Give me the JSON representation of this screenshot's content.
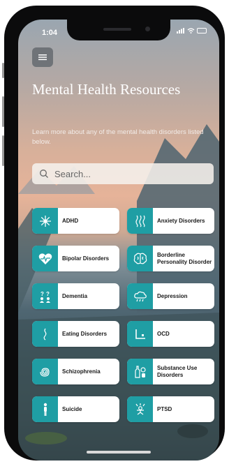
{
  "status_bar": {
    "time": "1:04"
  },
  "header": {
    "title": "Mental Health Resources",
    "subtitle": "Learn more about any of the mental health disorders listed below."
  },
  "search": {
    "placeholder": "Search..."
  },
  "colors": {
    "accent": "#1f9ea4",
    "card_bg": "#ffffff",
    "title": "#ffffff"
  },
  "disorders": [
    {
      "label": "ADHD",
      "icon": "snowflake-icon"
    },
    {
      "label": "Anxiety Disorders",
      "icon": "waves-icon"
    },
    {
      "label": "Bipolar Disorders",
      "icon": "heart-pulse-icon"
    },
    {
      "label": "Borderline Personality Disorder",
      "icon": "brain-icon"
    },
    {
      "label": "Dementia",
      "icon": "question-people-icon"
    },
    {
      "label": "Depression",
      "icon": "rain-cloud-icon"
    },
    {
      "label": "Eating Disorders",
      "icon": "body-silhouette-icon"
    },
    {
      "label": "OCD",
      "icon": "corner-square-icon"
    },
    {
      "label": "Schizophrenia",
      "icon": "spiral-icon"
    },
    {
      "label": "Substance Use Disorders",
      "icon": "bottle-pill-icon"
    },
    {
      "label": "Suicide",
      "icon": "person-standing-icon"
    },
    {
      "label": "PTSD",
      "icon": "figure-shock-icon"
    }
  ]
}
